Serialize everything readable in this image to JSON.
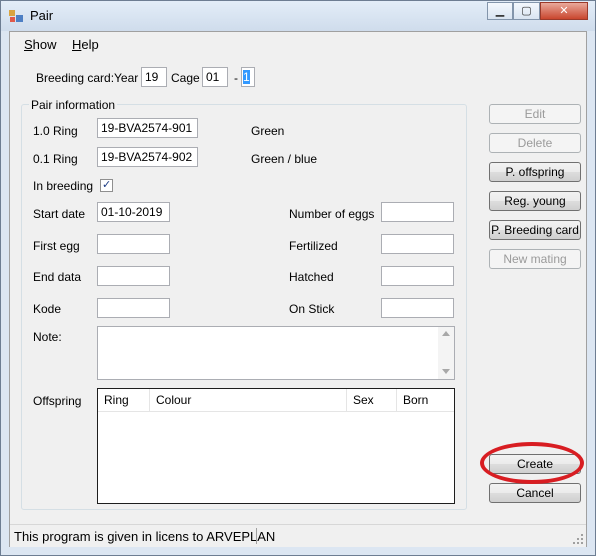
{
  "window": {
    "title": "Pair",
    "min_glyph": "▁",
    "max_glyph": "▢",
    "close_glyph": "✕"
  },
  "menu": {
    "show_rest": "how",
    "show_key": "S",
    "help_key": "H",
    "help_rest": "elp"
  },
  "breeding": {
    "label": "Breeding card:",
    "year_label": "Year",
    "year_value": "19",
    "cage_label": "Cage",
    "cage_value": "01",
    "dash": "-",
    "number_value": "1"
  },
  "pair_info": {
    "title": "Pair information",
    "ring10_label": "1.0 Ring",
    "ring10_value": "19-BVA2574-901",
    "ring10_colour": "Green",
    "ring01_label": "0.1 Ring",
    "ring01_value": "19-BVA2574-902",
    "ring01_colour": "Green / blue",
    "in_breeding_label": "In breeding",
    "in_breeding_checked": true,
    "check_glyph": "✓",
    "start_date_label": "Start date",
    "start_date_value": "01-10-2019",
    "first_egg_label": "First egg",
    "first_egg_value": "",
    "end_data_label": "End data",
    "end_data_value": "",
    "kode_label": "Kode",
    "kode_value": "",
    "eggs_label": "Number of eggs",
    "eggs_value": "",
    "fertilized_label": "Fertilized",
    "fertilized_value": "",
    "hatched_label": "Hatched",
    "hatched_value": "",
    "onstick_label": "On Stick",
    "onstick_value": "",
    "note_label": "Note:",
    "note_value": "",
    "offspring_label": "Offspring",
    "columns": [
      "Ring",
      "Colour",
      "Sex",
      "Born"
    ]
  },
  "buttons": {
    "edit": "Edit",
    "delete": "Delete",
    "p_offspring": "P. offspring",
    "reg_young": "Reg. young",
    "p_breeding_card": "P. Breeding card",
    "new_mating": "New mating",
    "create": "Create",
    "cancel": "Cancel"
  },
  "status": {
    "text": "This program is given in licens to ARVEPLAN"
  },
  "colors": {
    "highlight": "#d81d22",
    "selection": "#3399ff"
  }
}
